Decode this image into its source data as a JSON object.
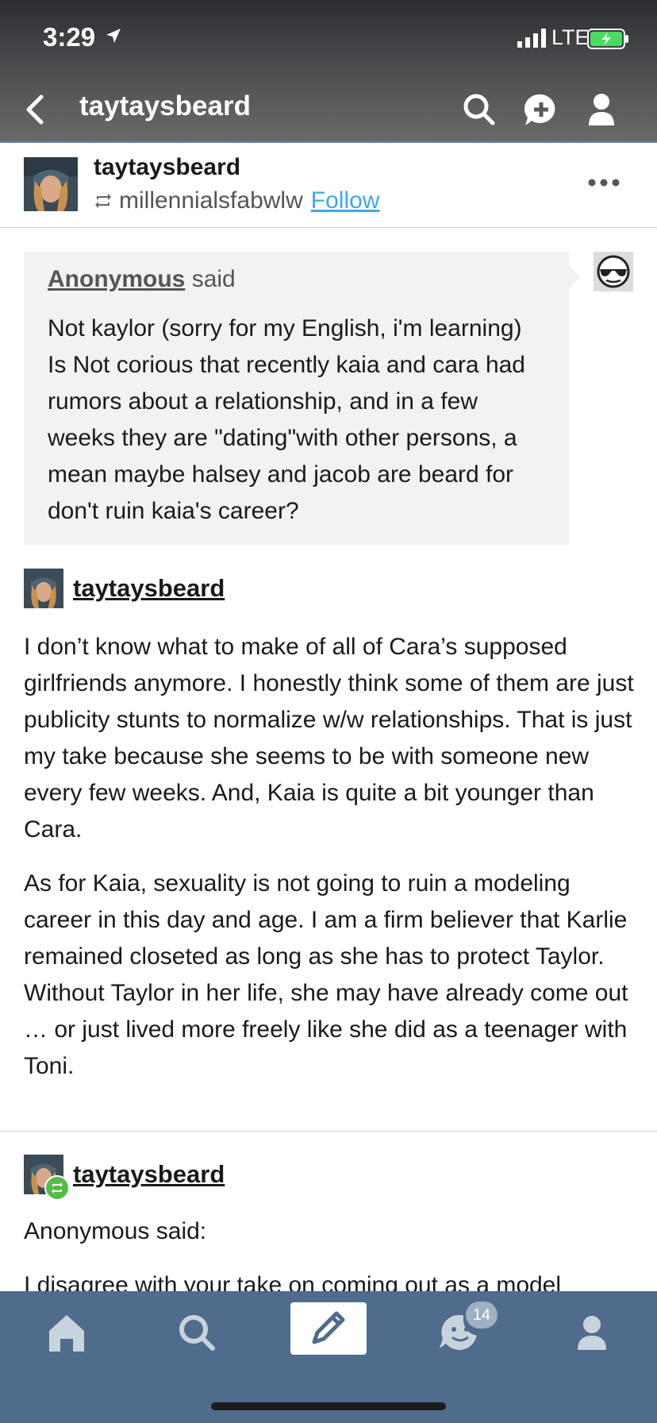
{
  "status": {
    "time": "3:29",
    "network": "LTE"
  },
  "nav": {
    "title": "taytaysbeard"
  },
  "post_header": {
    "blog_name": "taytaysbeard",
    "reblogged_from": "millennialsfabwlw",
    "follow_label": "Follow"
  },
  "ask": {
    "asker": "Anonymous",
    "said": "said",
    "question": "Not kaylor (sorry for my English, i'm learning) Is Not corious that recently kaia and cara had rumors about a relationship, and in a few weeks they are \"dating\"with other persons, a mean maybe halsey and jacob are beard for don't ruin kaia's career?"
  },
  "reply": {
    "username": "taytaysbeard",
    "paragraphs": [
      "I don’t know what to make of all of Cara’s supposed girlfriends anymore. I honestly think some of them are just publicity stunts to normalize w/w relationships. That is just my take because she seems to be with someone new every few weeks. And, Kaia is quite a bit younger than Cara.",
      "As for Kaia, sexuality is not going to ruin a modeling career in this day and age. I am a firm believer that Karlie remained closeted as long as she has to protect Taylor. Without Taylor in her life, she may have already come out … or just lived more freely like she did as a teenager with Toni."
    ]
  },
  "second_post": {
    "username": "taytaysbeard",
    "anon_said": "Anonymous said:",
    "truncated_text": "I disagree with your take on coming out as a model"
  },
  "tabbar": {
    "tabs": [
      {
        "name": "home",
        "icon": "home-icon"
      },
      {
        "name": "search",
        "icon": "search-icon"
      },
      {
        "name": "compose",
        "icon": "pencil-icon"
      },
      {
        "name": "activity",
        "icon": "smile-icon",
        "badge": "14"
      },
      {
        "name": "account",
        "icon": "person-icon"
      }
    ]
  },
  "colors": {
    "accent": "#3ea9e6",
    "tabbar": "#4f6c8c",
    "reblog_green": "#56bc48"
  }
}
